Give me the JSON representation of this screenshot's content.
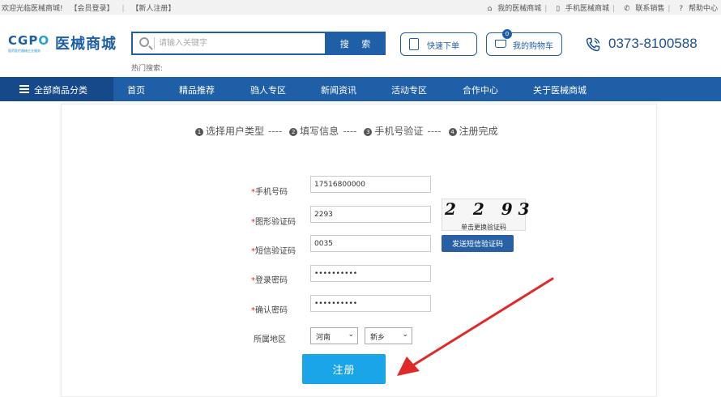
{
  "topbar": {
    "welcome": "欢迎光临医械商城!",
    "login": "【会员登录】",
    "register": "【新人注册】",
    "my_mall": "我的医械商城",
    "mobile_mall": "手机医械商城",
    "contact_sales": "联系销售",
    "help": "帮助中心"
  },
  "header": {
    "logo_en_prefix": "CGP",
    "logo_en_o": "O",
    "logo_cn": "医械商城",
    "logo_sub": "医药医疗器械企业服务",
    "search_placeholder": "请输入关键字",
    "search_button": "搜 索",
    "hot_label": "热门搜索:",
    "quick_order": "快速下单",
    "cart": "我的购物车",
    "cart_count": "0",
    "phone": "0373-8100588"
  },
  "nav": {
    "all_categories": "全部商品分类",
    "items": [
      "首页",
      "精品推荐",
      "驺人专区",
      "新闻资讯",
      "活动专区",
      "合作中心",
      "关于医械商城"
    ]
  },
  "steps": [
    {
      "num": "1",
      "label": "选择用户类型"
    },
    {
      "num": "2",
      "label": "填写信息"
    },
    {
      "num": "3",
      "label": "手机号验证"
    },
    {
      "num": "4",
      "label": "注册完成"
    }
  ],
  "step_separator": "----",
  "form": {
    "phone_label": "手机号码",
    "phone_value": "17516800000",
    "captcha_label": "图形验证码",
    "captcha_value": "2293",
    "sms_label": "短信验证码",
    "sms_value": "0035",
    "password_label": "登录密码",
    "password_value": "••••••••••",
    "confirm_label": "确认密码",
    "confirm_value": "••••••••••",
    "region_label": "所属地区",
    "province": "河南",
    "city": "新乡",
    "required_mark": "*",
    "captcha_image_text": "2 2 93",
    "captcha_refresh": "单击更换验证码",
    "send_sms": "发送短信验证码",
    "submit": "注册"
  },
  "colors": {
    "primary": "#1f5fa8",
    "nav_dark": "#16498a",
    "register": "#1aa5e8",
    "arrow": "#e02a2a",
    "required": "#e02020"
  }
}
